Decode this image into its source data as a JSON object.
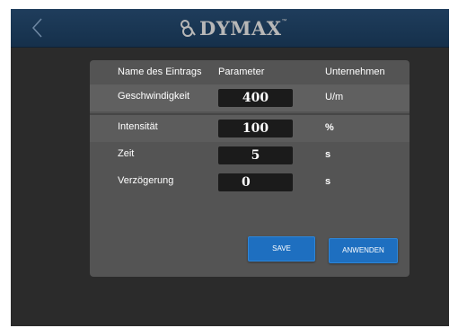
{
  "header": {
    "brand": "DYMAX"
  },
  "table": {
    "columns": [
      "Name des Eintrags",
      "Parameter",
      "Unternehmen"
    ],
    "rows": [
      {
        "name": "Geschwindigkeit",
        "value": "400",
        "unit": "U/m"
      },
      {
        "name": "Intensität",
        "value": "100",
        "unit": "%"
      },
      {
        "name": "Zeit",
        "value": "5",
        "unit": "s"
      },
      {
        "name": "Verzögerung",
        "value": "0",
        "unit": "s"
      }
    ]
  },
  "buttons": {
    "save": "SAVE",
    "apply": "ANWENDEN"
  },
  "icons": {
    "back": "chevron-left-icon",
    "logo": "dymax-logo-icon"
  },
  "colors": {
    "topbar": "#1a3753",
    "background": "#2b2b2b",
    "panel": "#545454",
    "button": "#1e6fc0"
  }
}
